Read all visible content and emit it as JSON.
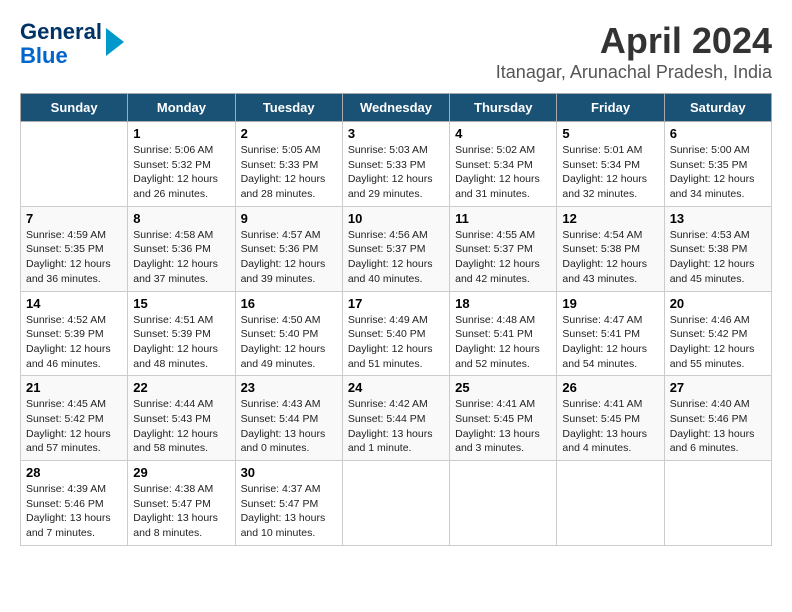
{
  "header": {
    "logo_line1": "General",
    "logo_line2": "Blue",
    "title": "April 2024",
    "subtitle": "Itanagar, Arunachal Pradesh, India"
  },
  "calendar": {
    "days_of_week": [
      "Sunday",
      "Monday",
      "Tuesday",
      "Wednesday",
      "Thursday",
      "Friday",
      "Saturday"
    ],
    "weeks": [
      [
        {
          "day": "",
          "info": ""
        },
        {
          "day": "1",
          "info": "Sunrise: 5:06 AM\nSunset: 5:32 PM\nDaylight: 12 hours\nand 26 minutes."
        },
        {
          "day": "2",
          "info": "Sunrise: 5:05 AM\nSunset: 5:33 PM\nDaylight: 12 hours\nand 28 minutes."
        },
        {
          "day": "3",
          "info": "Sunrise: 5:03 AM\nSunset: 5:33 PM\nDaylight: 12 hours\nand 29 minutes."
        },
        {
          "day": "4",
          "info": "Sunrise: 5:02 AM\nSunset: 5:34 PM\nDaylight: 12 hours\nand 31 minutes."
        },
        {
          "day": "5",
          "info": "Sunrise: 5:01 AM\nSunset: 5:34 PM\nDaylight: 12 hours\nand 32 minutes."
        },
        {
          "day": "6",
          "info": "Sunrise: 5:00 AM\nSunset: 5:35 PM\nDaylight: 12 hours\nand 34 minutes."
        }
      ],
      [
        {
          "day": "7",
          "info": "Sunrise: 4:59 AM\nSunset: 5:35 PM\nDaylight: 12 hours\nand 36 minutes."
        },
        {
          "day": "8",
          "info": "Sunrise: 4:58 AM\nSunset: 5:36 PM\nDaylight: 12 hours\nand 37 minutes."
        },
        {
          "day": "9",
          "info": "Sunrise: 4:57 AM\nSunset: 5:36 PM\nDaylight: 12 hours\nand 39 minutes."
        },
        {
          "day": "10",
          "info": "Sunrise: 4:56 AM\nSunset: 5:37 PM\nDaylight: 12 hours\nand 40 minutes."
        },
        {
          "day": "11",
          "info": "Sunrise: 4:55 AM\nSunset: 5:37 PM\nDaylight: 12 hours\nand 42 minutes."
        },
        {
          "day": "12",
          "info": "Sunrise: 4:54 AM\nSunset: 5:38 PM\nDaylight: 12 hours\nand 43 minutes."
        },
        {
          "day": "13",
          "info": "Sunrise: 4:53 AM\nSunset: 5:38 PM\nDaylight: 12 hours\nand 45 minutes."
        }
      ],
      [
        {
          "day": "14",
          "info": "Sunrise: 4:52 AM\nSunset: 5:39 PM\nDaylight: 12 hours\nand 46 minutes."
        },
        {
          "day": "15",
          "info": "Sunrise: 4:51 AM\nSunset: 5:39 PM\nDaylight: 12 hours\nand 48 minutes."
        },
        {
          "day": "16",
          "info": "Sunrise: 4:50 AM\nSunset: 5:40 PM\nDaylight: 12 hours\nand 49 minutes."
        },
        {
          "day": "17",
          "info": "Sunrise: 4:49 AM\nSunset: 5:40 PM\nDaylight: 12 hours\nand 51 minutes."
        },
        {
          "day": "18",
          "info": "Sunrise: 4:48 AM\nSunset: 5:41 PM\nDaylight: 12 hours\nand 52 minutes."
        },
        {
          "day": "19",
          "info": "Sunrise: 4:47 AM\nSunset: 5:41 PM\nDaylight: 12 hours\nand 54 minutes."
        },
        {
          "day": "20",
          "info": "Sunrise: 4:46 AM\nSunset: 5:42 PM\nDaylight: 12 hours\nand 55 minutes."
        }
      ],
      [
        {
          "day": "21",
          "info": "Sunrise: 4:45 AM\nSunset: 5:42 PM\nDaylight: 12 hours\nand 57 minutes."
        },
        {
          "day": "22",
          "info": "Sunrise: 4:44 AM\nSunset: 5:43 PM\nDaylight: 12 hours\nand 58 minutes."
        },
        {
          "day": "23",
          "info": "Sunrise: 4:43 AM\nSunset: 5:44 PM\nDaylight: 13 hours\nand 0 minutes."
        },
        {
          "day": "24",
          "info": "Sunrise: 4:42 AM\nSunset: 5:44 PM\nDaylight: 13 hours\nand 1 minute."
        },
        {
          "day": "25",
          "info": "Sunrise: 4:41 AM\nSunset: 5:45 PM\nDaylight: 13 hours\nand 3 minutes."
        },
        {
          "day": "26",
          "info": "Sunrise: 4:41 AM\nSunset: 5:45 PM\nDaylight: 13 hours\nand 4 minutes."
        },
        {
          "day": "27",
          "info": "Sunrise: 4:40 AM\nSunset: 5:46 PM\nDaylight: 13 hours\nand 6 minutes."
        }
      ],
      [
        {
          "day": "28",
          "info": "Sunrise: 4:39 AM\nSunset: 5:46 PM\nDaylight: 13 hours\nand 7 minutes."
        },
        {
          "day": "29",
          "info": "Sunrise: 4:38 AM\nSunset: 5:47 PM\nDaylight: 13 hours\nand 8 minutes."
        },
        {
          "day": "30",
          "info": "Sunrise: 4:37 AM\nSunset: 5:47 PM\nDaylight: 13 hours\nand 10 minutes."
        },
        {
          "day": "",
          "info": ""
        },
        {
          "day": "",
          "info": ""
        },
        {
          "day": "",
          "info": ""
        },
        {
          "day": "",
          "info": ""
        }
      ]
    ]
  }
}
